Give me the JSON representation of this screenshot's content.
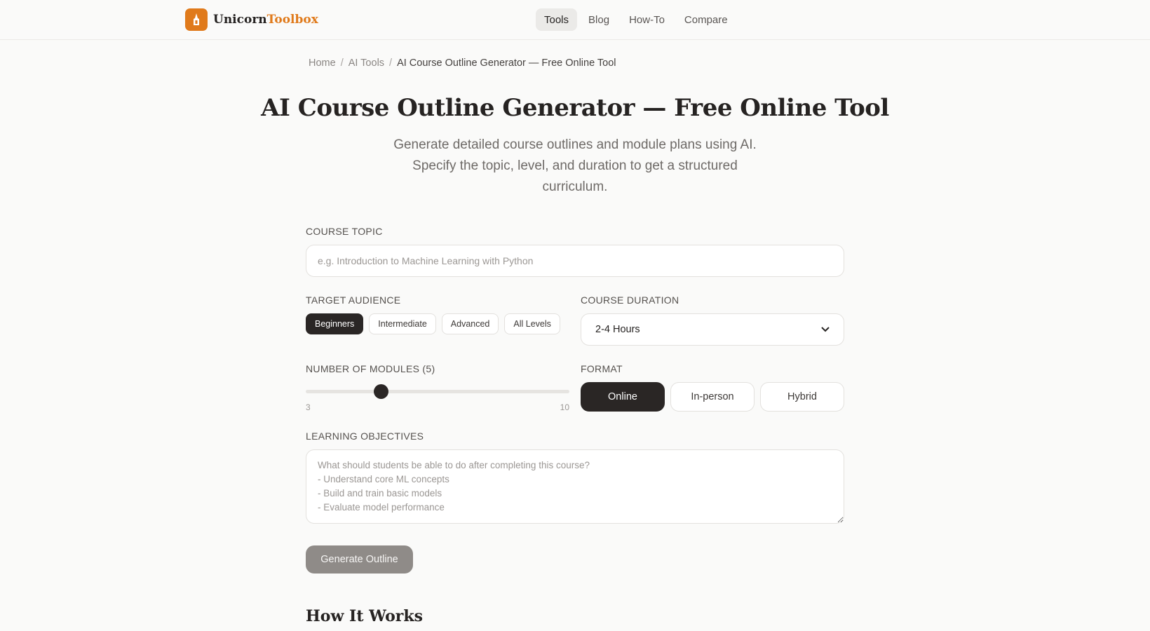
{
  "brand": {
    "name_part1": "Unicorn",
    "name_part2": "Toolbox",
    "accent": "#e07a1b"
  },
  "nav": {
    "items": [
      "Tools",
      "Blog",
      "How-To",
      "Compare"
    ],
    "active": "Tools"
  },
  "breadcrumb": {
    "home": "Home",
    "section": "AI Tools",
    "current": "AI Course Outline Generator — Free Online Tool"
  },
  "page": {
    "title": "AI Course Outline Generator — Free Online Tool",
    "subtitle": "Generate detailed course outlines and module plans using AI. Specify the topic, level, and duration to get a structured curriculum."
  },
  "form": {
    "topic": {
      "label": "COURSE TOPIC",
      "placeholder": "e.g. Introduction to Machine Learning with Python",
      "value": ""
    },
    "audience": {
      "label": "TARGET AUDIENCE",
      "options": [
        "Beginners",
        "Intermediate",
        "Advanced",
        "All Levels"
      ],
      "selected": "Beginners"
    },
    "duration": {
      "label": "COURSE DURATION",
      "value": "2-4 Hours"
    },
    "modules": {
      "label": "NUMBER OF MODULES (5)",
      "value": 5,
      "min": 3,
      "max": 10,
      "min_label": "3",
      "max_label": "10"
    },
    "format": {
      "label": "FORMAT",
      "options": [
        "Online",
        "In-person",
        "Hybrid"
      ],
      "selected": "Online"
    },
    "objectives": {
      "label": "LEARNING OBJECTIVES",
      "placeholder": "What should students be able to do after completing this course?\n- Understand core ML concepts\n- Build and train basic models\n- Evaluate model performance",
      "value": ""
    },
    "submit_label": "Generate Outline"
  },
  "section": {
    "how_it_works": "How It Works"
  }
}
